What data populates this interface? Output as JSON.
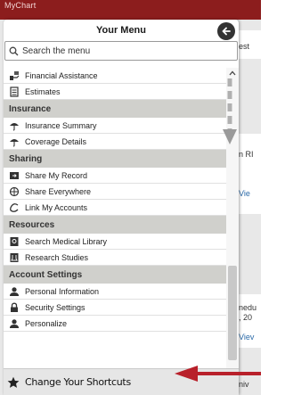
{
  "app": {
    "logo": "MyChart"
  },
  "background_fragments": [
    "est",
    "n RI",
    "Vie",
    "nedu",
    ", 20",
    "Viev",
    "niv"
  ],
  "menu": {
    "title": "Your Menu",
    "back_icon": "arrow-left-circle-icon",
    "search_placeholder": "Search the menu",
    "items_before": [
      {
        "label": "Financial Assistance",
        "icon": "hand-money-icon"
      },
      {
        "label": "Estimates",
        "icon": "calculator-icon"
      }
    ],
    "sections": [
      {
        "title": "Insurance",
        "items": [
          {
            "label": "Insurance Summary",
            "icon": "umbrella-icon"
          },
          {
            "label": "Coverage Details",
            "icon": "umbrella-icon"
          }
        ]
      },
      {
        "title": "Sharing",
        "items": [
          {
            "label": "Share My Record",
            "icon": "share-record-icon"
          },
          {
            "label": "Share Everywhere",
            "icon": "share-everywhere-icon"
          },
          {
            "label": "Link My Accounts",
            "icon": "link-icon"
          }
        ]
      },
      {
        "title": "Resources",
        "items": [
          {
            "label": "Search Medical Library",
            "icon": "library-icon"
          },
          {
            "label": "Research Studies",
            "icon": "research-icon"
          }
        ]
      },
      {
        "title": "Account Settings",
        "items": [
          {
            "label": "Personal Information",
            "icon": "person-icon"
          },
          {
            "label": "Security Settings",
            "icon": "lock-icon"
          },
          {
            "label": "Personalize",
            "icon": "person-icon"
          }
        ]
      }
    ],
    "shortcuts_label": "Change Your Shortcuts",
    "shortcuts_icon": "star-icon"
  },
  "colors": {
    "brand": "#8c1d1d",
    "annotation_arrow": "#b8202a",
    "section_bg": "#d0d0cc"
  }
}
